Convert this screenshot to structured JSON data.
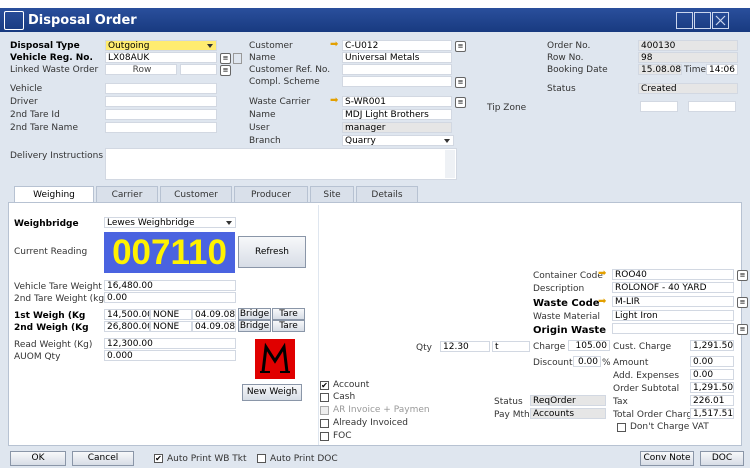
{
  "window": {
    "title": "Disposal Order"
  },
  "header": {
    "disposal_type_label": "Disposal Type",
    "disposal_type": "Outgoing",
    "vehicle_reg_label": "Vehicle Reg. No.",
    "vehicle_reg": "LX08AUK",
    "linked_waste_order_label": "Linked Waste Order",
    "row_label": "Row",
    "vehicle_label": "Vehicle",
    "driver_label": "Driver",
    "tare_id_label": "2nd Tare Id",
    "tare_name_label": "2nd Tare Name",
    "customer_label": "Customer",
    "customer": "C-U012",
    "name_label": "Name",
    "customer_name": "Universal Metals",
    "customer_ref_label": "Customer Ref. No.",
    "compl_scheme_label": "Compl. Scheme",
    "waste_carrier_label": "Waste Carrier",
    "waste_carrier": "S-WR001",
    "carrier_name_label": "Name",
    "carrier_name": "MDJ Light Brothers",
    "user_label": "User",
    "user": "manager",
    "branch_label": "Branch",
    "branch": "Quarry",
    "order_no_label": "Order No.",
    "order_no": "400130",
    "row_no_label": "Row No.",
    "row_no": "98",
    "booking_date_label": "Booking Date",
    "booking_date": "15.08.08",
    "time_label": "Time",
    "booking_time": "14:06",
    "status_label": "Status",
    "status": "Created",
    "tip_zone_label": "Tip Zone",
    "delivery_instructions_label": "Delivery Instructions"
  },
  "tabs": [
    "Weighing",
    "Carrier",
    "Customer",
    "Producer",
    "Site",
    "Details"
  ],
  "weighing": {
    "weighbridge_label": "Weighbridge",
    "weighbridge": "Lewes Weighbridge",
    "current_reading_label": "Current Reading",
    "current_reading": "007110",
    "refresh_label": "Refresh",
    "vehicle_tare_label": "Vehicle Tare Weight",
    "vehicle_tare": "16,480.00",
    "second_tare_label": "2nd Tare Weight (kg)",
    "second_tare": "0.00",
    "first_weigh_label": "1st Weigh (Kg",
    "first_weigh": "14,500.00",
    "first_weigh_mode": "NONE",
    "first_weigh_date": "04.09.08",
    "second_weigh_label": "2nd Weigh (Kg",
    "second_weigh": "26,800.00",
    "second_weigh_mode": "NONE",
    "second_weigh_date": "04.09.08",
    "bridge_label": "Bridge",
    "tare_label": "Tare",
    "read_weight_label": "Read Weight (Kg)",
    "read_weight": "12,300.00",
    "auom_label": "AUOM Qty",
    "auom_qty": "0.000",
    "new_weigh_label": "New Weigh"
  },
  "payment": {
    "account_label": "Account",
    "cash_label": "Cash",
    "ar_invoice_label": "AR Invoice + Paymen",
    "already_invoiced_label": "Already Invoiced",
    "foc_label": "FOC"
  },
  "qty": {
    "qty_label": "Qty",
    "qty": "12.30",
    "unit": "t"
  },
  "container": {
    "container_code_label": "Container Code",
    "container_code": "ROO40",
    "description_label": "Description",
    "description": "ROLONOF - 40 YARD",
    "waste_code_label": "Waste Code",
    "waste_code": "M-LIR",
    "waste_material_label": "Waste Material",
    "waste_material": "Light Iron",
    "origin_waste_label": "Origin Waste"
  },
  "totals": {
    "charge_label": "Charge",
    "charge": "105.00",
    "cust_charge_label": "Cust. Charge",
    "cust_charge": "1,291.50",
    "discount_label": "Discount",
    "discount": "0.00",
    "percent": "%",
    "amount_label": "Amount",
    "amount": "0.00",
    "add_expenses_label": "Add. Expenses",
    "add_expenses": "0.00",
    "order_subtotal_label": "Order Subtotal",
    "order_subtotal": "1,291.50",
    "tax_label": "Tax",
    "tax": "226.01",
    "total_label": "Total Order Charg",
    "total": "1,517.51",
    "dont_charge_vat_label": "Don't Charge VAT",
    "status_label": "Status",
    "status": "ReqOrder",
    "pay_mth_label": "Pay Mth.",
    "pay_mth": "Accounts"
  },
  "footer": {
    "ok_label": "OK",
    "cancel_label": "Cancel",
    "auto_print_wb_label": "Auto Print WB Tkt",
    "auto_print_doc_label": "Auto Print DOC",
    "conv_note_label": "Conv Note",
    "doc_label": "DOC"
  },
  "colors": {
    "title_bar": "#1e4389",
    "reading_bg": "#4a63e0",
    "reading_fg": "#fff200",
    "highlight": "#ffec70",
    "logo_red": "#e00000"
  }
}
